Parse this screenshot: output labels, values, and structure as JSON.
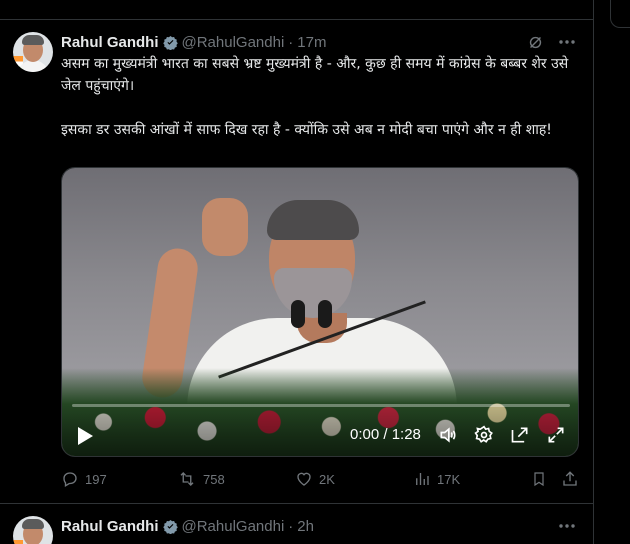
{
  "colors": {
    "background": "#000000",
    "text": "#e7e9ea",
    "muted": "#71767b",
    "border": "#2f3336",
    "accent": "#1d9bf0"
  },
  "tweet1": {
    "author_name": "Rahul Gandhi",
    "handle": "@RahulGandhi",
    "separator": "·",
    "time": "17m",
    "paragraph1": "असम का मुख्यमंत्री भारत का सबसे भ्रष्ट मुख्यमंत्री है - और, कुछ ही समय में कांग्रेस के बब्बर शेर उसे जेल पहुंचाएंगे।",
    "paragraph2": "इसका डर उसकी आंखों में साफ दिख रहा है - क्योंकि उसे अब न मोदी बचा पाएंगे और न ही शाह!",
    "video": {
      "timecode": "0:00 / 1:28",
      "progress": 0.0
    },
    "stats": {
      "replies": "197",
      "reposts": "758",
      "likes": "2K",
      "views": "17K"
    },
    "icons": [
      "verified-badge-icon",
      "grok-icon",
      "more-icon",
      "play-icon",
      "volume-icon",
      "settings-icon",
      "pip-icon",
      "fullscreen-icon",
      "reply-icon",
      "repost-icon",
      "like-icon",
      "views-icon",
      "bookmark-icon",
      "share-icon"
    ]
  },
  "tweet2": {
    "author_name": "Rahul Gandhi",
    "handle": "@RahulGandhi",
    "separator": "·",
    "time": "2h"
  }
}
